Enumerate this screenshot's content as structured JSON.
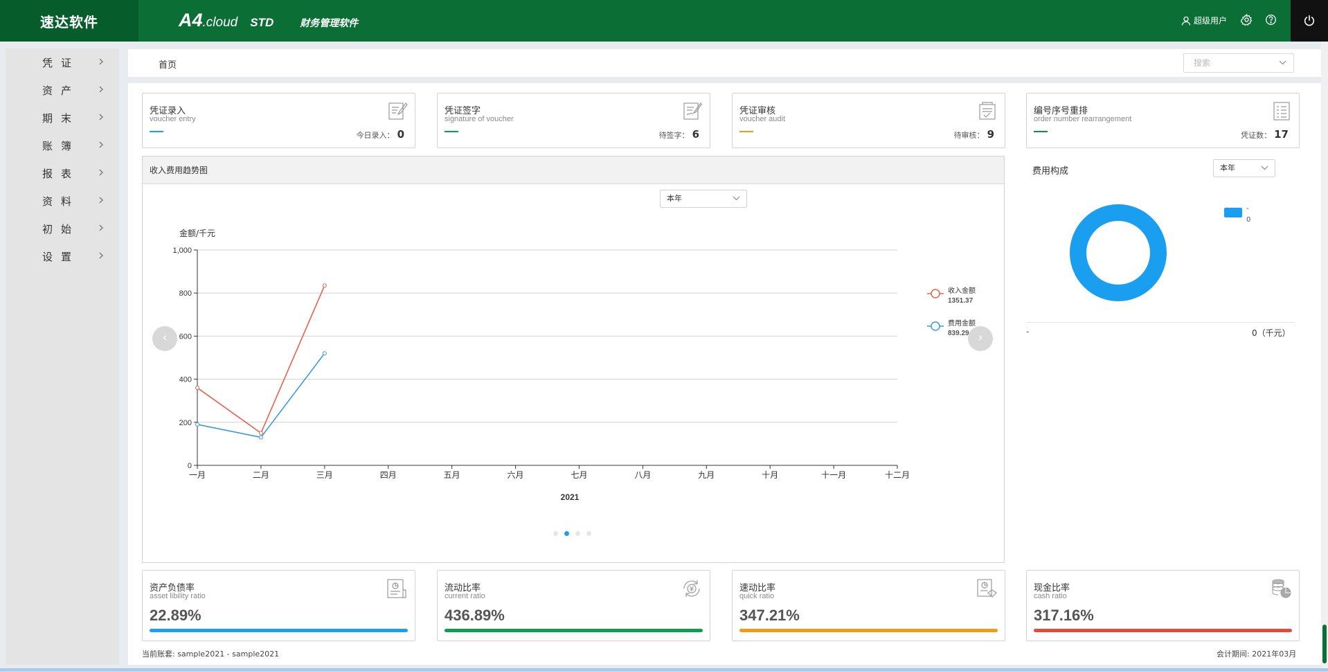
{
  "brand": "速达软件",
  "product": {
    "a4": "A4",
    "cloud": ".cloud",
    "edition": "STD",
    "name": "财务管理软件"
  },
  "top": {
    "user": "超级用户",
    "icons": [
      "user-icon",
      "gear-icon",
      "help-icon",
      "power-icon"
    ]
  },
  "sidebar": {
    "items": [
      {
        "label": "凭证"
      },
      {
        "label": "资产"
      },
      {
        "label": "期末"
      },
      {
        "label": "账簿"
      },
      {
        "label": "报表"
      },
      {
        "label": "资料"
      },
      {
        "label": "初始"
      },
      {
        "label": "设置"
      }
    ]
  },
  "breadcrumb": {
    "home": "首页"
  },
  "search": {
    "placeholder": "搜索"
  },
  "cards_top": [
    {
      "title": "凭证录入",
      "subtitle": "voucher entry",
      "count_label": "今日录入：",
      "count": "0",
      "color": "#1a9ff0",
      "icon": "voucher-edit-icon"
    },
    {
      "title": "凭证签字",
      "subtitle": "signature of voucher",
      "count_label": "待签字：",
      "count": "6",
      "color": "#0aa04d",
      "icon": "signature-icon"
    },
    {
      "title": "凭证审核",
      "subtitle": "voucher audit",
      "count_label": "待审核：",
      "count": "9",
      "color": "#f39b16",
      "icon": "audit-icon"
    },
    {
      "title": "编号序号重排",
      "subtitle": "order number rearrangement",
      "count_label": "凭证数：",
      "count": "17",
      "color": "#0a8f45",
      "icon": "list-icon"
    }
  ],
  "trend": {
    "title": "收入费用趋势图",
    "period": "本年",
    "nav_prev": "‹",
    "nav_next": "›"
  },
  "chart_data": {
    "type": "line",
    "ylabel": "金额/千元",
    "xlabel": "2021",
    "categories": [
      "一月",
      "二月",
      "三月",
      "四月",
      "五月",
      "六月",
      "七月",
      "八月",
      "九月",
      "十月",
      "十一月",
      "十二月"
    ],
    "ylim": [
      0,
      1000
    ],
    "yticks": [
      "0",
      "200",
      "400",
      "600",
      "800",
      "1,000"
    ],
    "series": [
      {
        "name": "收入金额",
        "total": "1351.37",
        "color": "#e8604c",
        "values": [
          360,
          150,
          835
        ]
      },
      {
        "name": "费用金额",
        "total": "839.29",
        "color": "#3a9ae8",
        "values": [
          190,
          130,
          520
        ]
      }
    ]
  },
  "cost": {
    "title": "费用构成",
    "period": "本年",
    "legend_name": "-",
    "legend_value": "0",
    "row_label": "-",
    "row_value": "0（千元）",
    "ring_color": "#1a9ff0"
  },
  "cards_bottom": [
    {
      "title": "资产负债率",
      "subtitle": "asset libility ratio",
      "value": "22.89%",
      "color": "#1a9ff0",
      "progress": 1.0,
      "icon": "chart-doc-icon"
    },
    {
      "title": "流动比率",
      "subtitle": "current ratio",
      "value": "436.89%",
      "color": "#0aa04d",
      "progress": 1.0,
      "icon": "currency-cycle-icon"
    },
    {
      "title": "速动比率",
      "subtitle": "quick ratio",
      "value": "347.21%",
      "color": "#f39b16",
      "progress": 1.0,
      "icon": "fast-doc-icon"
    },
    {
      "title": "现金比率",
      "subtitle": "cash ratio",
      "value": "317.16%",
      "color": "#e24a3b",
      "progress": 1.0,
      "icon": "coins-icon"
    }
  ],
  "footer": {
    "account_set": "当前账套: sample2021 - sample2021",
    "period": "会计期间: 2021年03月"
  }
}
